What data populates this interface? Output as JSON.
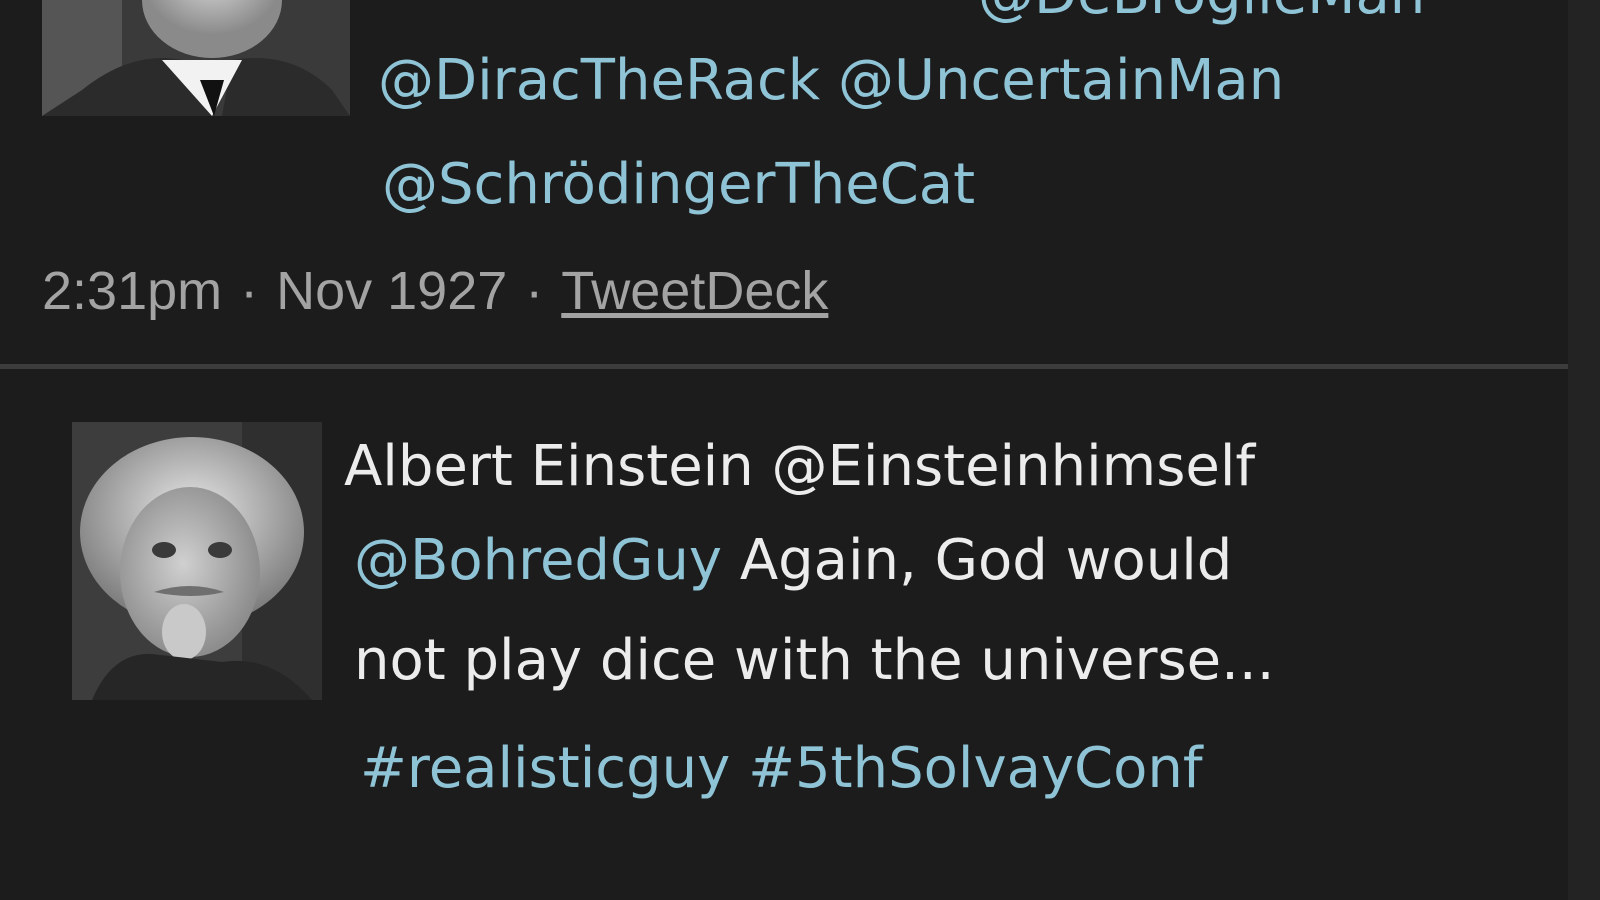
{
  "tweet1": {
    "cut_line": "@DeBroglieMan",
    "mentions_line": [
      "@DiracTheRack",
      "@UncertainMan"
    ],
    "mention_last": "@SchrödingerTheCat",
    "time": "2:31pm",
    "date": "Nov 1927",
    "separator": "·",
    "source": "TweetDeck"
  },
  "tweet2": {
    "author": "Albert Einstein",
    "handle": "@Einsteinhimself",
    "reply_to": "@BohredGuy",
    "text_part1": "Again, God would",
    "text_part2": "not play dice with the universe...",
    "hashtags": [
      "#realisticguy",
      "#5thSolvayConf"
    ]
  },
  "colors": {
    "background": "#1c1c1c",
    "text": "#ececec",
    "link": "#8fc3d6",
    "meta": "#a3a3a3"
  }
}
